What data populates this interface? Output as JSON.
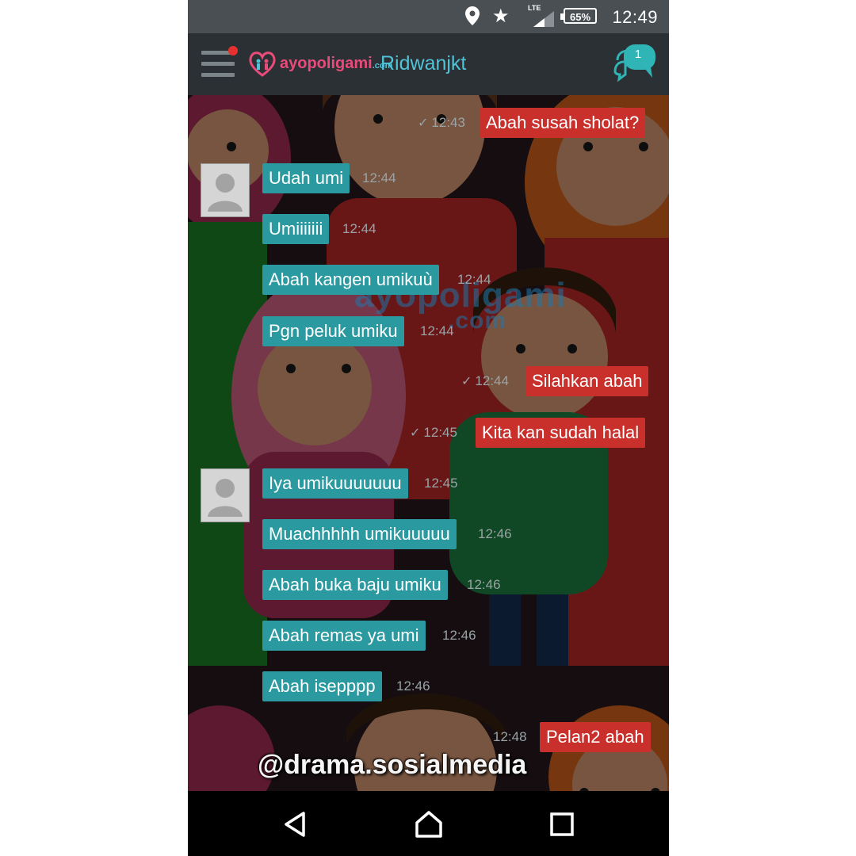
{
  "status_bar": {
    "time": "12:49",
    "battery": "65%",
    "network": "LTE"
  },
  "header": {
    "logo_main": "ayopoligami",
    "logo_sub": ".com",
    "contact_name": "Ridwanjkt",
    "chat_badge_count": "1"
  },
  "watermark": {
    "main": "ayopoligami",
    "sub": ".com"
  },
  "messages": [
    {
      "dir": "out",
      "text": "Abah susah sholat?",
      "time": "12:43"
    },
    {
      "dir": "in",
      "text": "Udah umi",
      "time": "12:44"
    },
    {
      "dir": "in",
      "text": "Umiiiiiii",
      "time": "12:44"
    },
    {
      "dir": "in",
      "text": "Abah kangen umikuù",
      "time": "12:44"
    },
    {
      "dir": "in",
      "text": "Pgn peluk umiku",
      "time": "12:44"
    },
    {
      "dir": "out",
      "text": "Silahkan abah",
      "time": "12:44"
    },
    {
      "dir": "out",
      "text": "Kita kan sudah halal",
      "time": "12:45"
    },
    {
      "dir": "in",
      "text": "Iya umikuuuuuuu",
      "time": "12:45"
    },
    {
      "dir": "in",
      "text": "Muachhhhh umikuuuuu",
      "time": "12:46"
    },
    {
      "dir": "in",
      "text": "Abah buka baju umiku",
      "time": "12:46"
    },
    {
      "dir": "in",
      "text": "Abah remas ya umi",
      "time": "12:46"
    },
    {
      "dir": "in",
      "text": "Abah isepppp",
      "time": "12:46"
    },
    {
      "dir": "out",
      "text": "Pelan2 abah",
      "time": "12:48"
    }
  ],
  "credit": "@drama.sosialmedia",
  "colors": {
    "incoming": "#2b9aa0",
    "outgoing": "#c9302c",
    "accent": "#4fc3d8",
    "header": "#2b3035"
  },
  "icons": [
    "menu-icon",
    "location-icon",
    "star-icon",
    "signal-icon",
    "battery-icon",
    "chat-bubble-icon",
    "back-icon",
    "home-icon",
    "recents-icon"
  ]
}
